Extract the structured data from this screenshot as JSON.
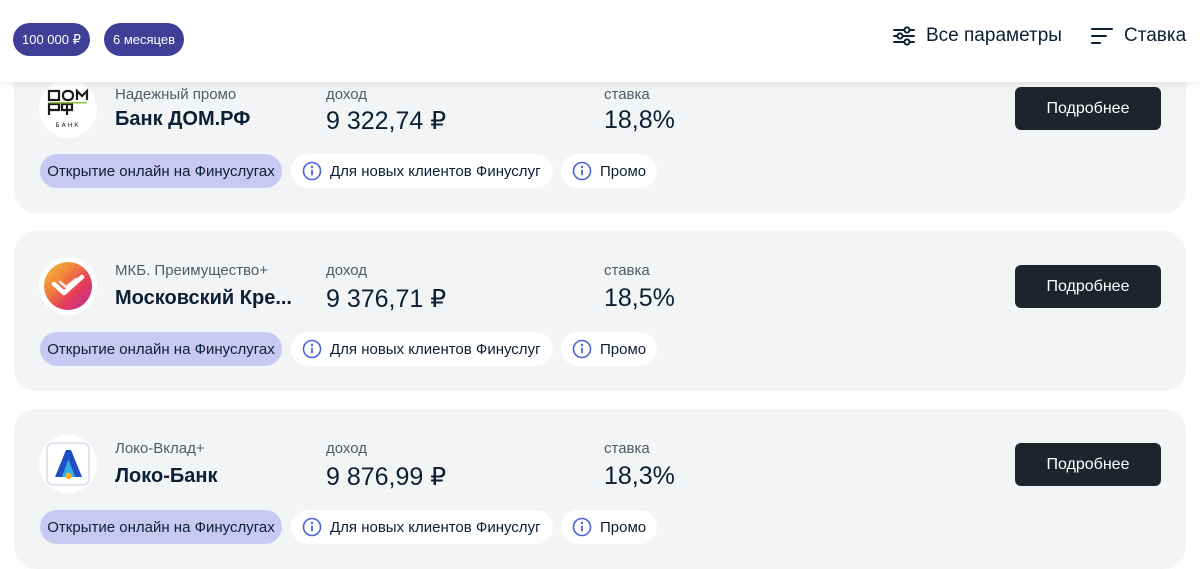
{
  "filters": {
    "amount": "100 000 ₽",
    "term": "6 месяцев"
  },
  "toolbar": {
    "params_label": "Все параметры",
    "sort_label": "Ставка"
  },
  "offers": [
    {
      "product": "Надежный промо",
      "bank": "Банк ДОМ.РФ",
      "income_label": "доход",
      "income": "9 322,74 ₽",
      "rate_label": "ставка",
      "rate": "18,8%",
      "button": "Подробнее",
      "tags": [
        "Открытие онлайн на Финуслугах",
        "Для новых клиентов Финуслуг",
        "Промо"
      ]
    },
    {
      "product": "МКБ. Преимущество+",
      "bank": "Московский Кре...",
      "income_label": "доход",
      "income": "9 376,71 ₽",
      "rate_label": "ставка",
      "rate": "18,5%",
      "button": "Подробнее",
      "tags": [
        "Открытие онлайн на Финуслугах",
        "Для новых клиентов Финуслуг",
        "Промо"
      ]
    },
    {
      "product": "Локо-Вклад+",
      "bank": "Локо-Банк",
      "income_label": "доход",
      "income": "9 876,99 ₽",
      "rate_label": "ставка",
      "rate": "18,3%",
      "button": "Подробнее",
      "tags": [
        "Открытие онлайн на Финуслугах",
        "Для новых клиентов Финуслуг",
        "Промо"
      ]
    }
  ],
  "colors": {
    "chip_bg": "#3f3f98",
    "card_bg": "#f3f4f5",
    "button_bg": "#1f242c",
    "online_tag_bg": "#c9c8f2",
    "info_icon": "#4a64d6"
  },
  "icons": [
    "sliders-icon",
    "sort-icon",
    "info-icon",
    "domrf-logo",
    "mkb-logo",
    "loko-logo"
  ]
}
